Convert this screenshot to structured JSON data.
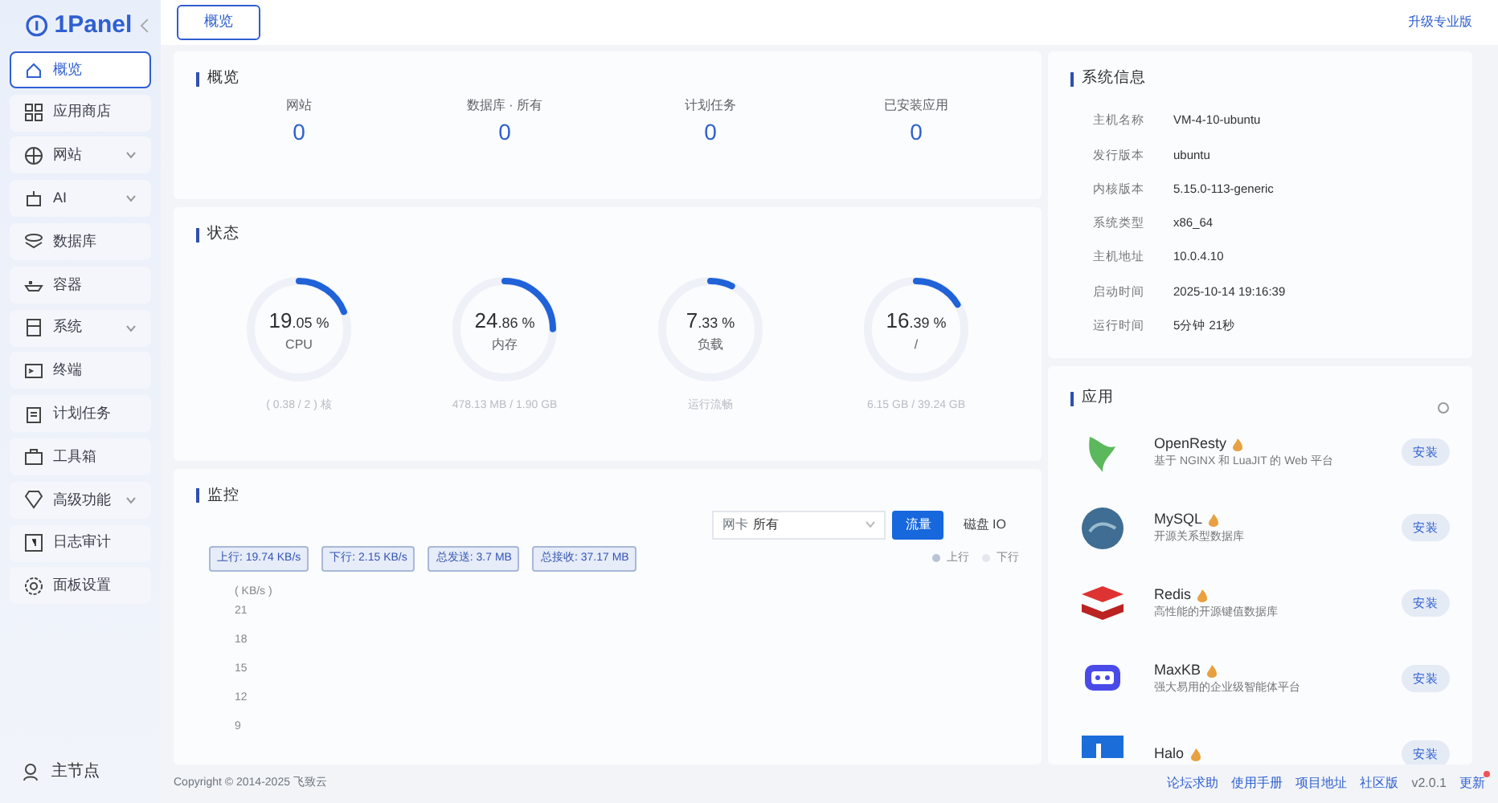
{
  "logo": {
    "text": "1Panel"
  },
  "sidebar": {
    "items": [
      {
        "label": "概览",
        "kind": "link",
        "selected": true
      },
      {
        "label": "应用商店",
        "kind": "link",
        "selected": false
      },
      {
        "label": "网站",
        "kind": "group",
        "selected": false
      },
      {
        "label": "AI",
        "kind": "group",
        "selected": false
      },
      {
        "label": "数据库",
        "kind": "link",
        "selected": false
      },
      {
        "label": "容器",
        "kind": "link",
        "selected": false
      },
      {
        "label": "系统",
        "kind": "group",
        "selected": false
      },
      {
        "label": "终端",
        "kind": "link",
        "selected": false
      },
      {
        "label": "计划任务",
        "kind": "link",
        "selected": false
      },
      {
        "label": "工具箱",
        "kind": "link",
        "selected": false
      },
      {
        "label": "高级功能",
        "kind": "group",
        "selected": false
      },
      {
        "label": "日志审计",
        "kind": "link",
        "selected": false
      },
      {
        "label": "面板设置",
        "kind": "link",
        "selected": false
      }
    ],
    "node": "主节点"
  },
  "topbar": {
    "tabs": [
      {
        "label": "概览",
        "selected": true
      }
    ],
    "upgrade": "升级专业版"
  },
  "overview": {
    "title": "概览",
    "stats": [
      {
        "label": "网站",
        "value": "0"
      },
      {
        "label": "数据库 · 所有",
        "value": "0"
      },
      {
        "label": "计划任务",
        "value": "0"
      },
      {
        "label": "已安装应用",
        "value": "0"
      }
    ]
  },
  "status": {
    "title": "状态",
    "gauges": [
      {
        "int": "19",
        "dec": ".05",
        "unit": "%",
        "name": "CPU",
        "detail": "( 0.38 / 2 ) 核",
        "level": 0.1905
      },
      {
        "int": "24",
        "dec": ".86",
        "unit": "%",
        "name": "内存",
        "detail": "478.13 MB / 1.90 GB",
        "level": 0.2486
      },
      {
        "int": "7",
        "dec": ".33",
        "unit": "%",
        "name": "负载",
        "detail": "运行流畅",
        "level": 0.0733
      },
      {
        "int": "16",
        "dec": ".39",
        "unit": "%",
        "name": "/",
        "detail": "6.15 GB / 39.24 GB",
        "level": 0.1639
      }
    ]
  },
  "monitor": {
    "title": "监控",
    "select_label": "网卡",
    "select_value": "所有",
    "buttons": [
      {
        "label": "流量",
        "selected": true
      },
      {
        "label": "磁盘 IO",
        "selected": false
      }
    ],
    "tags": [
      "上行: 19.74 KB/s",
      "下行: 2.15 KB/s",
      "总发送: 3.7 MB",
      "总接收: 37.17 MB"
    ],
    "legend": [
      {
        "label": "上行",
        "color": "#b9c3d6"
      },
      {
        "label": "下行",
        "color": "#e3e7ee"
      }
    ],
    "unit": "( KB/s )",
    "yticks": [
      "21",
      "18",
      "15",
      "12",
      "9"
    ]
  },
  "sysinfo": {
    "title": "系统信息",
    "rows": [
      {
        "label": "主机名称",
        "value": "VM-4-10-ubuntu"
      },
      {
        "label": "发行版本",
        "value": "ubuntu"
      },
      {
        "label": "内核版本",
        "value": "5.15.0-113-generic"
      },
      {
        "label": "系统类型",
        "value": "x86_64"
      },
      {
        "label": "主机地址",
        "value": "10.0.4.10"
      },
      {
        "label": "启动时间",
        "value": "2025-10-14 19:16:39"
      },
      {
        "label": "运行时间",
        "value": "5分钟 21秒"
      }
    ]
  },
  "apps": {
    "title": "应用",
    "items": [
      {
        "name": "OpenResty",
        "desc": "基于 NGINX 和 LuaJIT 的 Web 平台",
        "action": "安装"
      },
      {
        "name": "MySQL",
        "desc": "开源关系型数据库",
        "action": "安装"
      },
      {
        "name": "Redis",
        "desc": "高性能的开源键值数据库",
        "action": "安装"
      },
      {
        "name": "MaxKB",
        "desc": "强大易用的企业级智能体平台",
        "action": "安装"
      },
      {
        "name": "Halo",
        "action": "安装"
      }
    ]
  },
  "footer": {
    "copyright": "Copyright © 2014-2025 飞致云",
    "links": [
      "论坛求助",
      "使用手册",
      "项目地址",
      "社区版"
    ],
    "version": "v2.0.1",
    "update": "更新"
  }
}
